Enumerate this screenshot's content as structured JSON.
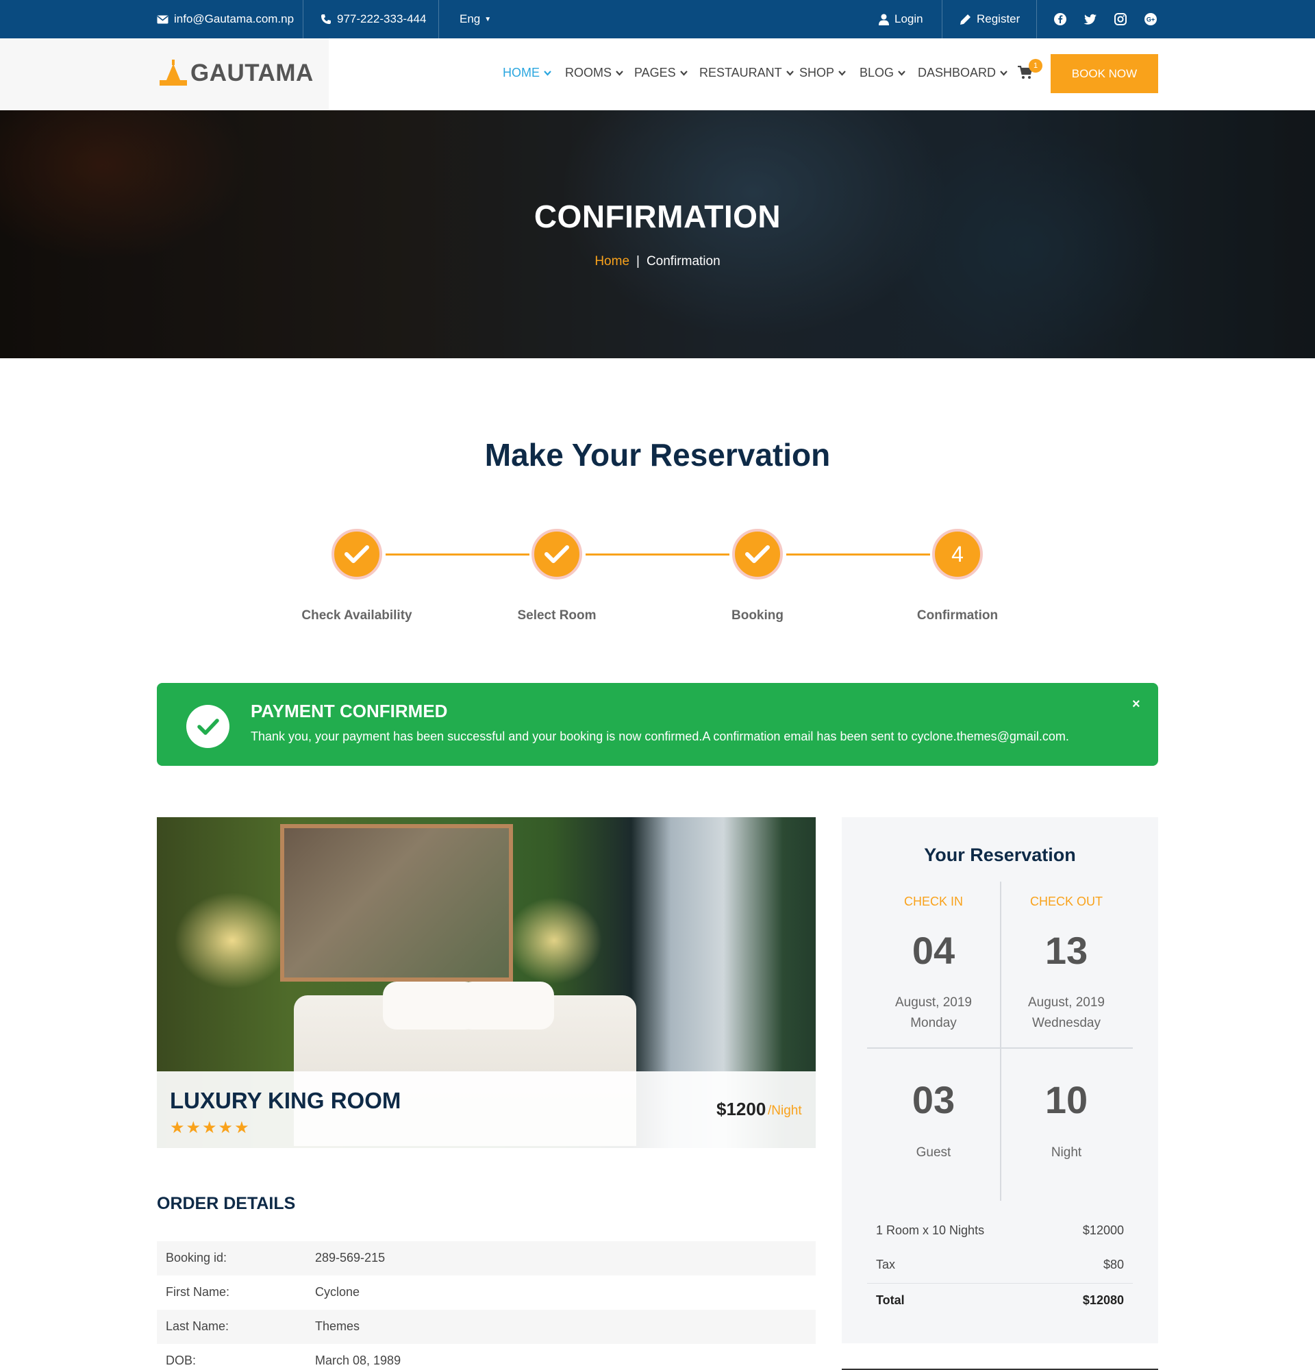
{
  "topbar": {
    "email": "info@Gautama.com.np",
    "phone": "977-222-333-444",
    "language": "Eng",
    "login": "Login",
    "register": "Register",
    "social_icons": [
      "facebook-icon",
      "twitter-icon",
      "instagram-icon",
      "google-plus-icon"
    ]
  },
  "header": {
    "logo_text": "GAUTAMA",
    "nav": [
      "HOME",
      "ROOMS",
      "PAGES",
      "RESTAURANT",
      "SHOP",
      "BLOG",
      "DASHBOARD"
    ],
    "active_nav": "HOME",
    "cart_count": "1",
    "book_now": "BOOK NOW"
  },
  "hero": {
    "title": "CONFIRMATION",
    "breadcrumb_home": "Home",
    "breadcrumb_sep": "|",
    "breadcrumb_current": "Confirmation"
  },
  "reservation": {
    "title": "Make Your Reservation",
    "steps": [
      {
        "label": "Check Availability",
        "state": "done"
      },
      {
        "label": "Select Room",
        "state": "done"
      },
      {
        "label": "Booking",
        "state": "done"
      },
      {
        "label": "Confirmation",
        "state": "current",
        "number": "4"
      }
    ]
  },
  "alert": {
    "title": "PAYMENT CONFIRMED",
    "message": "Thank you, your payment has been successful and your booking is now confirmed.A confirmation email has been sent to cyclone.themes@gmail.com.",
    "close": "×"
  },
  "room": {
    "name": "LUXURY KING ROOM",
    "stars": "★★★★★",
    "rating": 5,
    "price": "$1200",
    "per": "/Night"
  },
  "order": {
    "title": "ORDER DETAILS",
    "rows": [
      {
        "label": "Booking id:",
        "value": "289-569-215"
      },
      {
        "label": "First Name:",
        "value": "Cyclone"
      },
      {
        "label": "Last Name:",
        "value": "Themes"
      },
      {
        "label": "DOB:",
        "value": "March 08, 1989"
      }
    ]
  },
  "summary": {
    "title": "Your Reservation",
    "check_in": {
      "label": "CHECK IN",
      "day": "04",
      "month": "August, 2019",
      "weekday": "Monday"
    },
    "check_out": {
      "label": "CHECK OUT",
      "day": "13",
      "month": "August, 2019",
      "weekday": "Wednesday"
    },
    "guests": {
      "value": "03",
      "label": "Guest"
    },
    "nights": {
      "value": "10",
      "label": "Night"
    },
    "lines": [
      {
        "label": "1 Room x 10 Nights",
        "amount": "$12000"
      },
      {
        "label": "Tax",
        "amount": "$80"
      }
    ],
    "total": {
      "label": "Total",
      "amount": "$12080"
    }
  },
  "colors": {
    "topbar": "#0a4b80",
    "accent": "#f9a21b",
    "nav_active": "#2aa6df",
    "success": "#22ad4e",
    "heading": "#0e2a47"
  }
}
